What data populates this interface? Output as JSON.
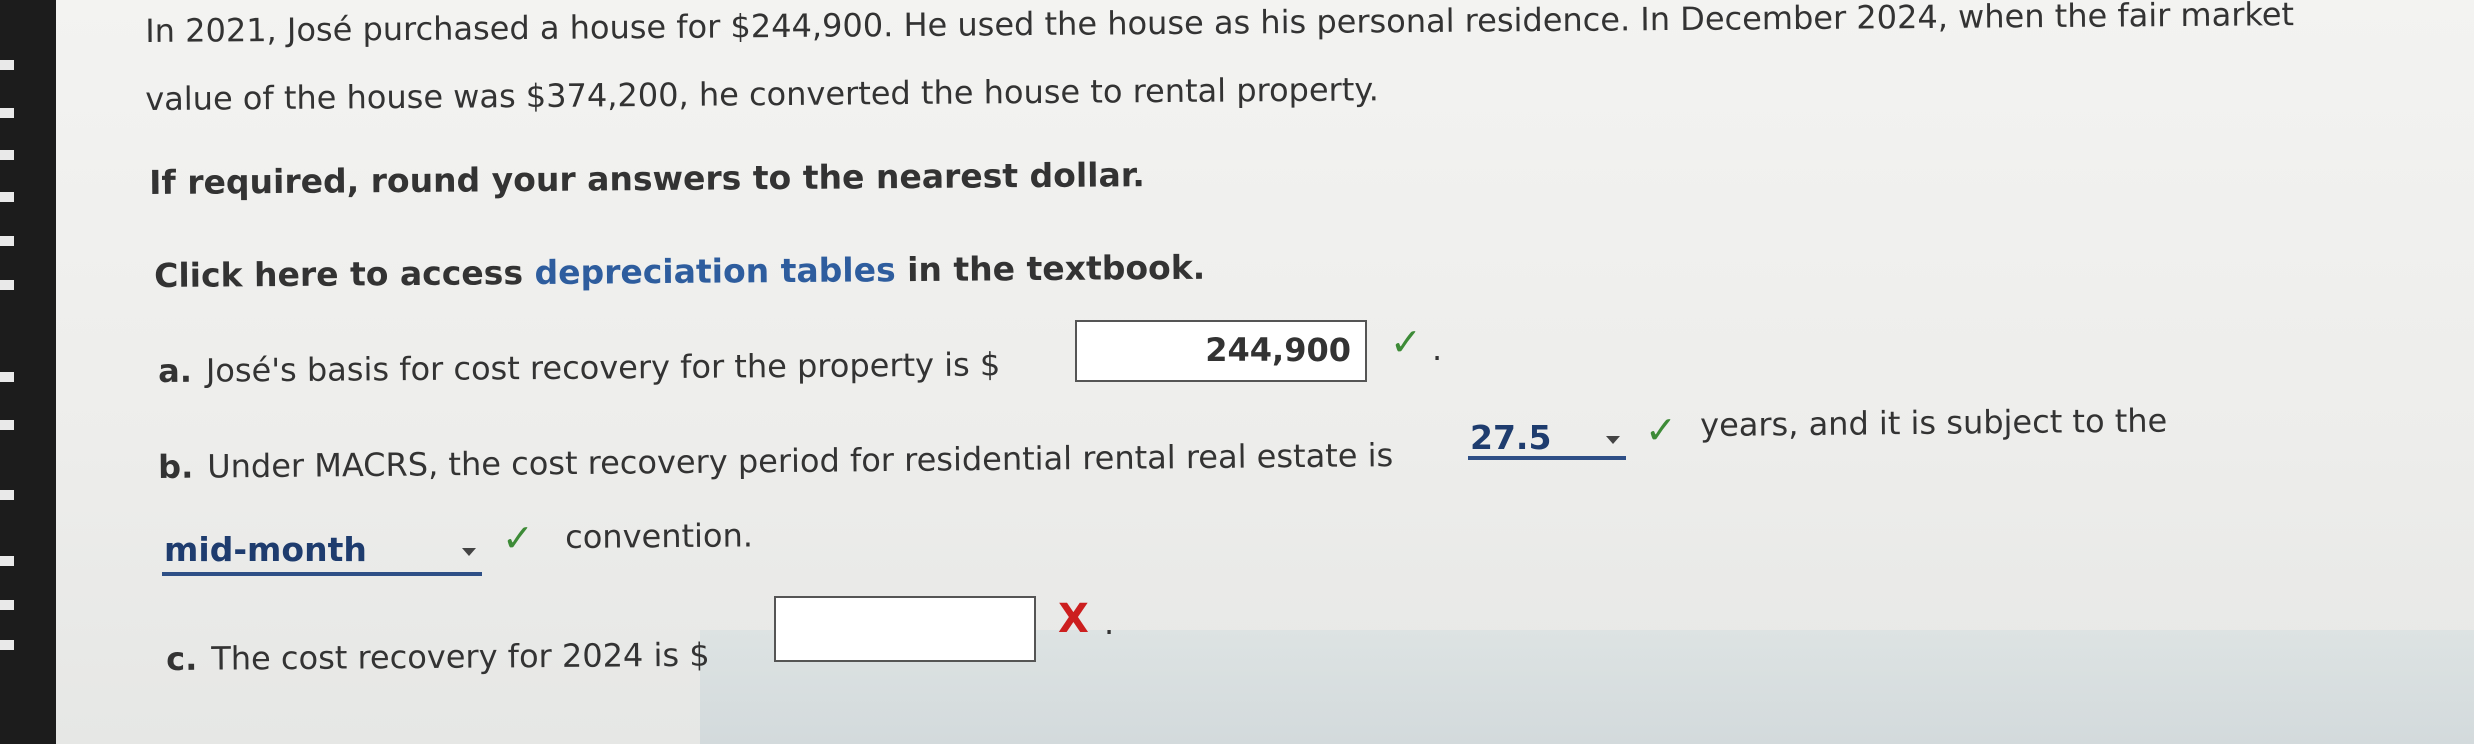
{
  "problem": {
    "line1": "In 2021, José purchased a house for $244,900. He used the house as his personal residence. In December 2024, when the fair market",
    "line2": "value of the house was $374,200, he converted the house to rental property."
  },
  "instruction": "If required, round your answers to the nearest dollar.",
  "tables_link": {
    "before": "Click here to access ",
    "link_text": "depreciation tables",
    "after": " in the textbook."
  },
  "part_a": {
    "letter": "a.",
    "text": "José's basis for cost recovery for the property is $",
    "answer_value": "244,900",
    "status": "correct",
    "suffix": "."
  },
  "part_b": {
    "letter": "b.",
    "text_before": "Under MACRS, the cost recovery period for residential rental real estate is",
    "period_selected": "27.5",
    "period_status": "correct",
    "text_middle": "years, and it is subject to the",
    "convention_selected": "mid-month",
    "convention_status": "correct",
    "text_after": "convention."
  },
  "part_c": {
    "letter": "c.",
    "text": "The cost recovery for 2024 is $",
    "answer_value": "",
    "status": "incorrect",
    "suffix": "."
  },
  "icons": {
    "correct": "✓",
    "incorrect": "X"
  },
  "colors": {
    "link": "#2e5d9e",
    "correct": "#3d8b37",
    "incorrect": "#cc1f1f",
    "select_underline": "#2e4f86"
  }
}
